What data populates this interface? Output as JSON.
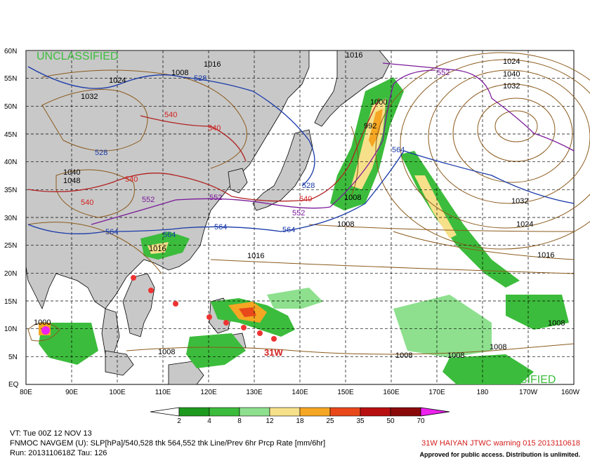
{
  "map": {
    "classification_top": "UNCLASSIFIED",
    "classification_bottom": "UNCLASSIFIED",
    "lat_labels": [
      "60N",
      "55N",
      "50N",
      "45N",
      "40N",
      "35N",
      "30N",
      "25N",
      "20N",
      "15N",
      "10N",
      "5N",
      "EQ"
    ],
    "lon_labels": [
      "80E",
      "90E",
      "100E",
      "110E",
      "120E",
      "130E",
      "140E",
      "150E",
      "160E",
      "170E",
      "180",
      "170W",
      "160W"
    ],
    "storm_label": "31W",
    "highs": [
      "1024",
      "1032",
      "1040",
      "1048"
    ],
    "slp_labels": [
      "1016",
      "1024",
      "1032",
      "1040",
      "1048",
      "1040",
      "1032",
      "1024",
      "1016",
      "1008",
      "1000",
      "992",
      "1008",
      "1016",
      "1024",
      "1032",
      "1000",
      "1008",
      "1008",
      "1008",
      "1008",
      "1008",
      "1016",
      "1016",
      "1008"
    ],
    "thk_labels": [
      "540",
      "540",
      "540",
      "540",
      "540",
      "552",
      "552",
      "552",
      "552",
      "528",
      "528",
      "528",
      "564",
      "564",
      "564",
      "564",
      "564"
    ]
  },
  "colorbar": {
    "ticks": [
      "2",
      "4",
      "8",
      "12",
      "18",
      "25",
      "35",
      "50",
      "70"
    ],
    "colors": [
      "#1e9a1e",
      "#3cbc3c",
      "#8ee08e",
      "#f7e08a",
      "#f5a623",
      "#e8481a",
      "#b81010",
      "#8a0a0a",
      "#ee22ee"
    ]
  },
  "footer": {
    "vt": "VT: Tue 00Z 12 NOV 13",
    "desc": "FNMOC NAVGEM (U): SLP[hPa]/540,528 thk 564,552 thk Line/Prev 6hr Prcp Rate [mm/6hr]",
    "run": "Run: 2013110618Z Tau: 126",
    "warning": "31W HAIYAN JTWC warning 015 2013110618",
    "approval": "Approved for public access. Distribution is unlimited."
  }
}
